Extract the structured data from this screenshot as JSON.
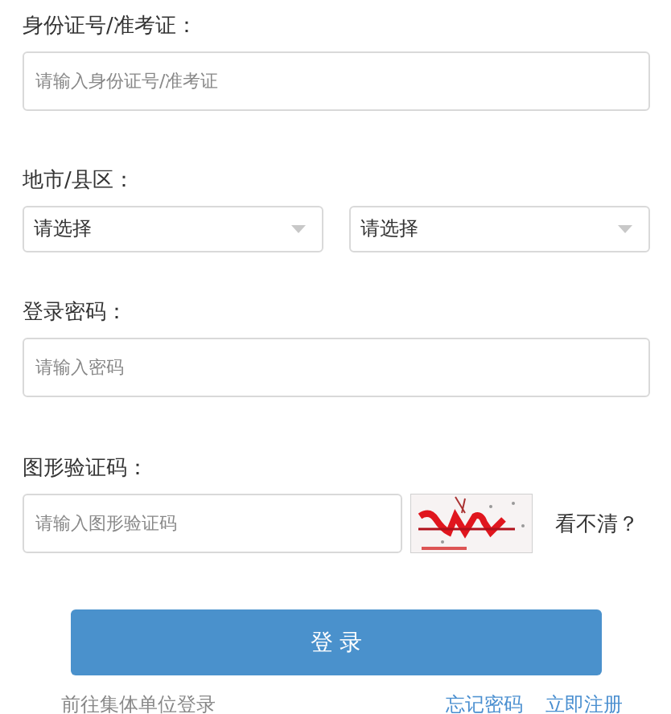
{
  "id_field": {
    "label": "身份证号/准考证：",
    "placeholder": "请输入身份证号/准考证"
  },
  "region": {
    "label": "地市/县区：",
    "selects": [
      {
        "value": "请选择"
      },
      {
        "value": "请选择"
      }
    ]
  },
  "password": {
    "label": "登录密码：",
    "placeholder": "请输入密码"
  },
  "captcha": {
    "label": "图形验证码：",
    "placeholder": "请输入图形验证码",
    "refresh": "看不清？"
  },
  "login_button": "登 录",
  "links": {
    "group_login": "前往集体单位登录",
    "forgot": "忘记密码",
    "register": "立即注册"
  }
}
